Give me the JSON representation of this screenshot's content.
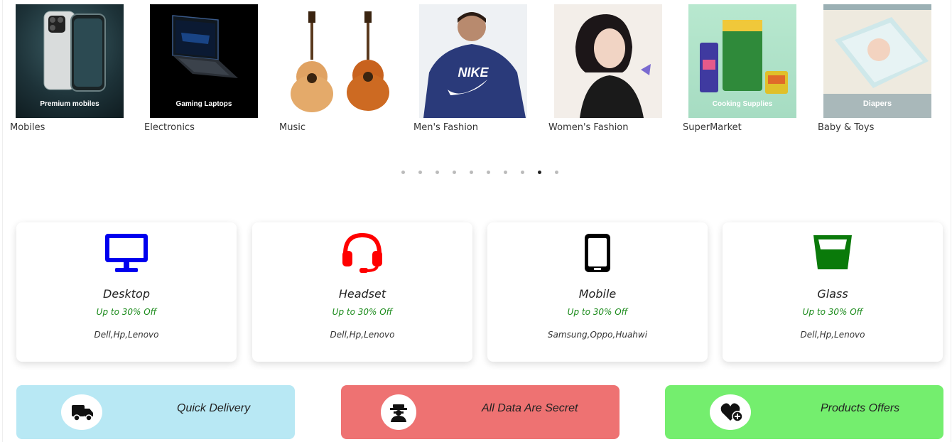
{
  "categories": [
    {
      "name": "Mobiles",
      "caption": "Premium mobiles"
    },
    {
      "name": "Electronics",
      "caption": "Gaming Laptops"
    },
    {
      "name": "Music",
      "caption": ""
    },
    {
      "name": "Men's Fashion",
      "caption": "NIKE"
    },
    {
      "name": "Women's Fashion",
      "caption": ""
    },
    {
      "name": "SuperMarket",
      "caption": "Cooking Supplies"
    },
    {
      "name": "Baby & Toys",
      "caption": "Diapers"
    }
  ],
  "carousel": {
    "dot_count": 10,
    "active_dot": 9
  },
  "cards": [
    {
      "title": "Desktop",
      "offer": "Up to 30% Off",
      "brands": "Dell,Hp,Lenovo",
      "icon": "desktop-icon",
      "color": "#0000ee"
    },
    {
      "title": "Headset",
      "offer": "Up to 30% Off",
      "brands": "Dell,Hp,Lenovo",
      "icon": "headset-icon",
      "color": "#ff0000"
    },
    {
      "title": "Mobile",
      "offer": "Up to 30% Off",
      "brands": "Samsung,Oppo,Huahwi",
      "icon": "mobile-icon",
      "color": "#000000"
    },
    {
      "title": "Glass",
      "offer": "Up to 30% Off",
      "brands": "Dell,Hp,Lenovo",
      "icon": "glass-icon",
      "color": "#0a7a0a"
    }
  ],
  "banners": [
    {
      "label": "Quick Delivery",
      "icon": "truck-icon",
      "color": "#b8e8f4"
    },
    {
      "label": "All Data Are Secret",
      "icon": "user-secret-icon",
      "color": "#ee7272"
    },
    {
      "label": "Products Offers",
      "icon": "heart-plus-icon",
      "color": "#74ee6e"
    }
  ]
}
